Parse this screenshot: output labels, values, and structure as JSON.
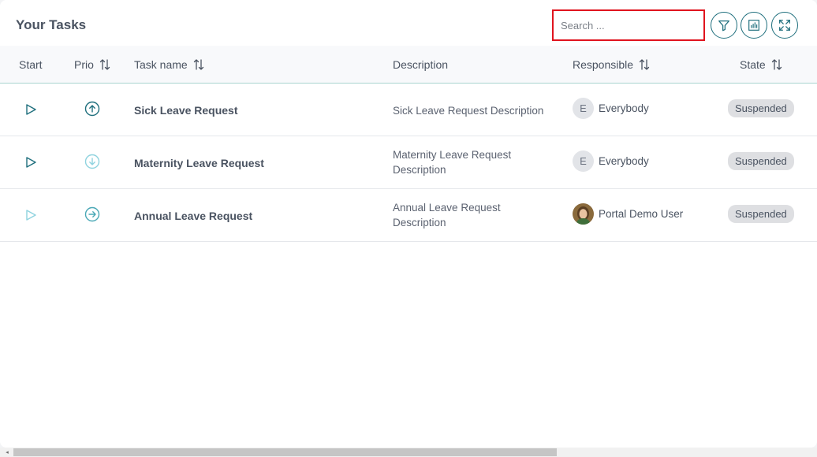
{
  "header": {
    "title": "Your Tasks",
    "search_placeholder": "Search ..."
  },
  "toolbar": {
    "filter_icon": "filter-icon",
    "columns_icon": "columns-icon",
    "expand_icon": "expand-icon"
  },
  "columns": {
    "start": "Start",
    "prio": "Prio",
    "task_name": "Task name",
    "description": "Description",
    "responsible": "Responsible",
    "state": "State"
  },
  "rows": [
    {
      "name": "Sick Leave Request",
      "desc_line1": "Sick Leave Request Description",
      "desc_line2": "",
      "responsible": "Everybody",
      "avatar_letter": "E",
      "state": "Suspended",
      "prio": "high"
    },
    {
      "name": "Maternity Leave Request",
      "desc_line1": "Maternity Leave Request",
      "desc_line2": "Description",
      "responsible": "Everybody",
      "avatar_letter": "E",
      "state": "Suspended",
      "prio": "low"
    },
    {
      "name": "Annual Leave Request",
      "desc_line1": "Annual Leave Request",
      "desc_line2": "Description",
      "responsible": "Portal Demo User",
      "avatar_letter": "",
      "state": "Suspended",
      "prio": "normal"
    }
  ],
  "colors": {
    "accent": "#1f6f7d",
    "search_border": "#e0141e",
    "prio_low": "#8fd3df",
    "prio_normal": "#4aa8b6"
  }
}
